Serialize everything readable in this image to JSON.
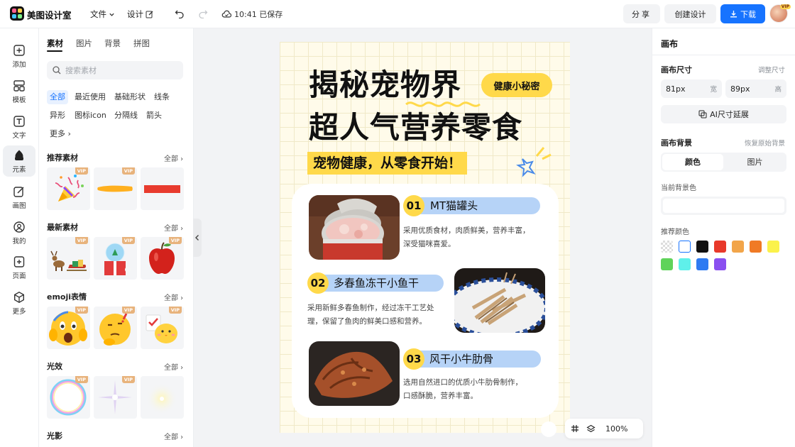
{
  "app": {
    "title": "美图设计室"
  },
  "topbar": {
    "file_label": "文件",
    "design_label": "设计",
    "saved_text": "10:41 已保存",
    "share_label": "分享",
    "create_label": "创建设计",
    "download_label": "下载",
    "vip_badge": "VIP",
    "accent": "#1673ff"
  },
  "rail": {
    "items": [
      {
        "label": "添加",
        "icon": "plus-square-icon"
      },
      {
        "label": "模板",
        "icon": "template-icon"
      },
      {
        "label": "文字",
        "icon": "text-icon"
      },
      {
        "label": "元素",
        "icon": "shapes-icon"
      },
      {
        "label": "画图",
        "icon": "edit-icon"
      },
      {
        "label": "我的",
        "icon": "user-icon"
      },
      {
        "label": "页面",
        "icon": "page-add-icon"
      },
      {
        "label": "更多",
        "icon": "cube-icon"
      }
    ],
    "active": "元素"
  },
  "panel": {
    "tabs": [
      "素材",
      "图片",
      "背景",
      "拼图"
    ],
    "active_tab": "素材",
    "search_placeholder": "搜索素材",
    "chips": [
      "全部",
      "最近使用",
      "基础形状",
      "线条",
      "异形",
      "图标icon",
      "分隔线",
      "箭头",
      "更多"
    ],
    "active_chip": "全部",
    "all_label": "全部",
    "sections": [
      {
        "title": "推荐素材",
        "thumbs": [
          "party-popper",
          "yellow-brush-stroke",
          "red-bar"
        ]
      },
      {
        "title": "最新素材",
        "thumbs": [
          "reindeer-sleigh",
          "snow-globe-gift",
          "red-apple"
        ]
      },
      {
        "title": "emoji表情",
        "thumbs": [
          "shocked-emoji",
          "thinking-emoji",
          "chick-emoji"
        ]
      },
      {
        "title": "光效",
        "thumbs": [
          "bubble-ring",
          "sparkle-star",
          "soft-glow"
        ]
      },
      {
        "title": "光影",
        "thumbs": []
      }
    ],
    "vip_label": "VIP"
  },
  "poster": {
    "title_line1": "揭秘宠物界",
    "title_line2": "超人气营养零食",
    "badge": "健康小秘密",
    "subtitle": "宠物健康，从零食开始！",
    "items": [
      {
        "num": "01",
        "name": "MT猫罐头",
        "desc_line1": "采用优质食材，肉质鲜美，营养丰富，",
        "desc_line2": "深受猫咪喜爱。"
      },
      {
        "num": "02",
        "name": "多春鱼冻干小鱼干",
        "desc_line1": "采用新鲜多春鱼制作，经过冻干工艺处",
        "desc_line2": "理，保留了鱼肉的鲜美口感和营养。"
      },
      {
        "num": "03",
        "name": "风干小牛肋骨",
        "desc_line1": "选用自然进口的优质小牛肋骨制作，",
        "desc_line2": "口感酥脆，营养丰富。"
      }
    ]
  },
  "floatbar": {
    "zoom": "100%"
  },
  "rpanel": {
    "title": "画布",
    "size_label": "画布尺寸",
    "resize_label": "调整尺寸",
    "width_value": "81px",
    "width_unit": "宽",
    "height_value": "89px",
    "height_unit": "高",
    "ai_expand_label": "AI尺寸延展",
    "bg_label": "画布背景",
    "restore_label": "恢复原始背景",
    "seg_color": "颜色",
    "seg_image": "图片",
    "current_bg_label": "当前背景色",
    "recommend_label": "推荐颜色",
    "swatches": [
      "transparent",
      "#ffffff",
      "#111111",
      "#e8392b",
      "#f2a54a",
      "#f07a25",
      "#fbf24b",
      "#5fd35a",
      "#5ff0ea",
      "#2e7bf2",
      "#8a4ff0"
    ]
  }
}
